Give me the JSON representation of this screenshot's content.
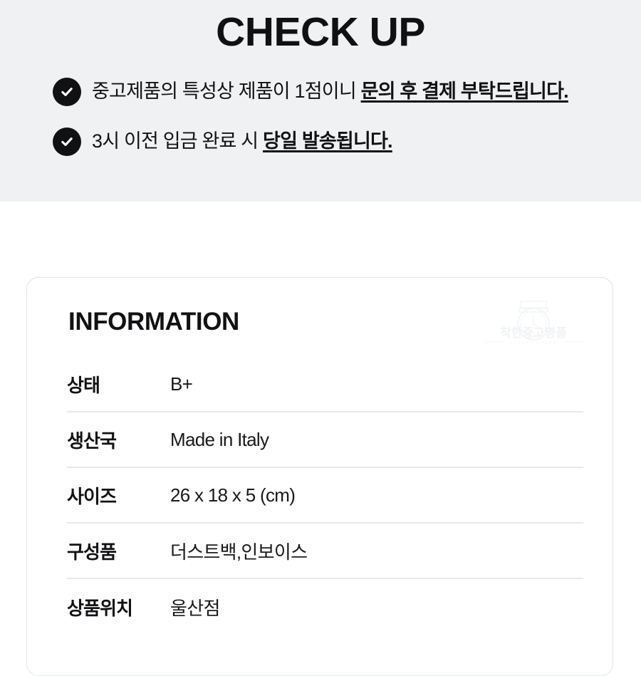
{
  "checkup": {
    "title": "CHECK UP",
    "bullets": [
      {
        "icon": "check-circle-icon",
        "normal": "중고제품의 특성상 제품이 1점이니 ",
        "emphasis": "문의 후 결제 부탁드립니다."
      },
      {
        "icon": "check-circle-icon",
        "normal": "3시 이전 입금 완료 시 ",
        "emphasis": "당일 발송됩니다."
      }
    ]
  },
  "information": {
    "title": "INFORMATION",
    "watermark": {
      "icon": "watch-logo-icon",
      "brand": "착한중고명품",
      "tagline": "LUXURY SHOPS"
    },
    "rows": [
      {
        "label": "상태",
        "value": "B+"
      },
      {
        "label": "생산국",
        "value": "Made in Italy"
      },
      {
        "label": "사이즈",
        "value": "26 x 18 x 5 (cm)"
      },
      {
        "label": "구성품",
        "value": "더스트백,인보이스"
      },
      {
        "label": "상품위치",
        "value": "울산점"
      }
    ]
  },
  "colors": {
    "band_background": "#f0f1f3",
    "page_background": "#ffffff",
    "text_primary": "#121214",
    "icon_fill": "#111113",
    "card_border": "#e2e4e6",
    "divider": "#e8e9eb"
  }
}
